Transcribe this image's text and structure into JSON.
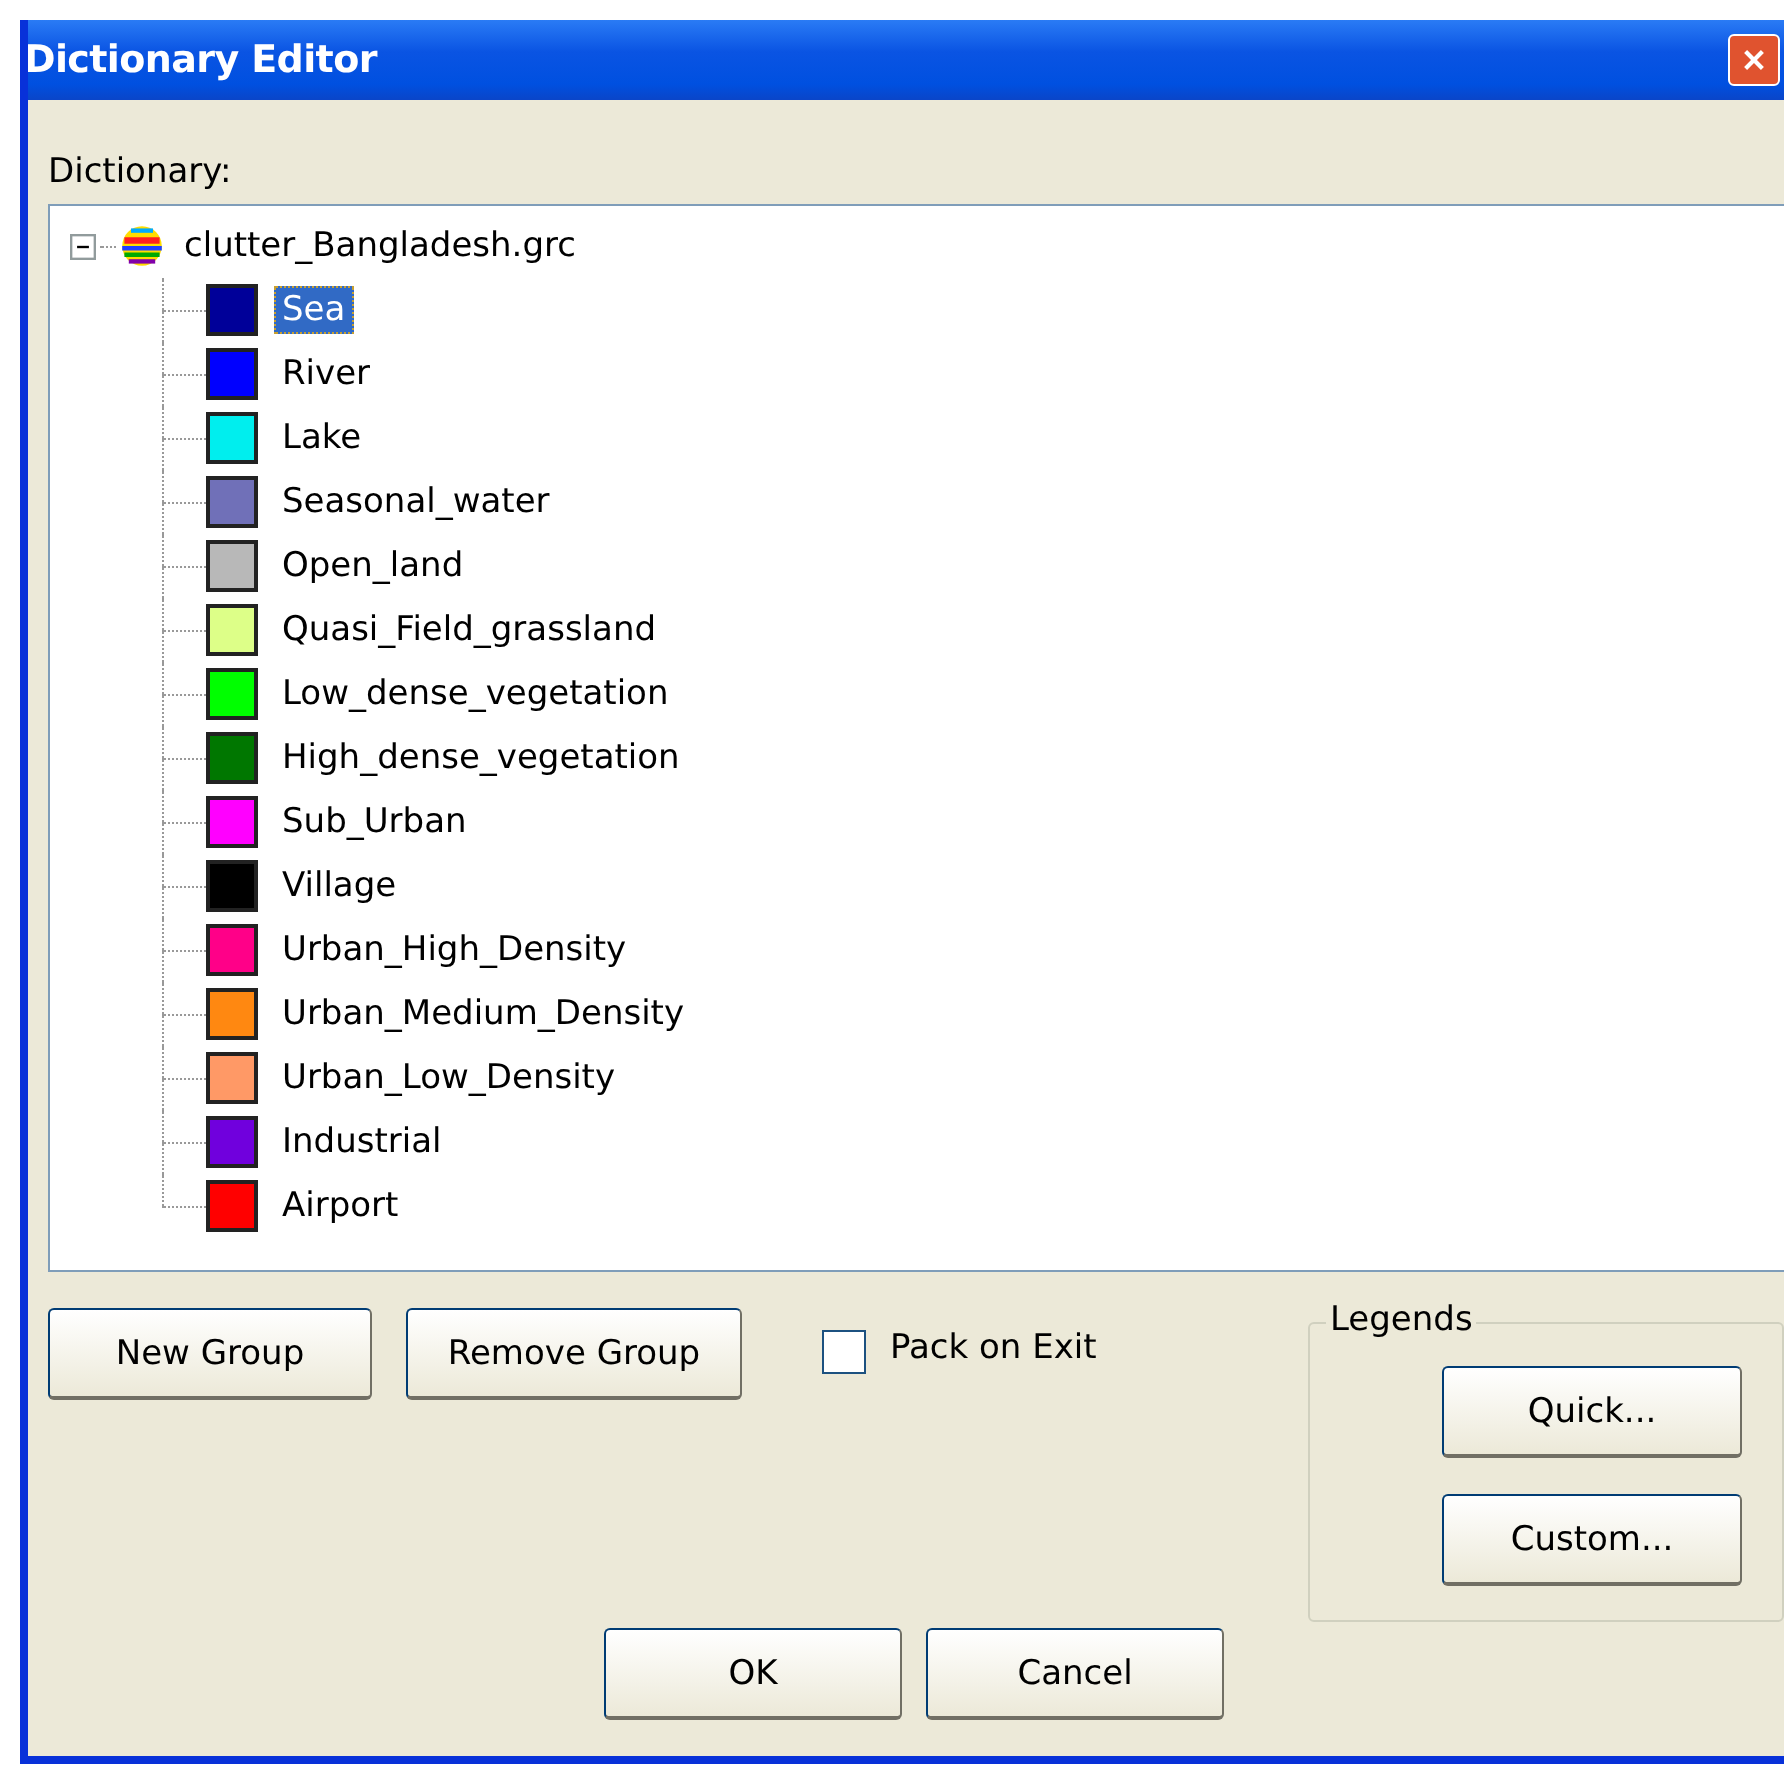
{
  "window": {
    "title": "Dictionary Editor"
  },
  "dictionary_label": "Dictionary:",
  "tree": {
    "label": "clutter_Bangladesh.grc",
    "expanded": true,
    "children": [
      {
        "label": "Sea",
        "color": "#000099",
        "selected": true
      },
      {
        "label": "River",
        "color": "#0000ff",
        "selected": false
      },
      {
        "label": "Lake",
        "color": "#00eeee",
        "selected": false
      },
      {
        "label": "Seasonal_water",
        "color": "#7070b8",
        "selected": false
      },
      {
        "label": "Open_land",
        "color": "#b8b8b8",
        "selected": false
      },
      {
        "label": "Quasi_Field_grassland",
        "color": "#ddff88",
        "selected": false
      },
      {
        "label": "Low_dense_vegetation",
        "color": "#00ff00",
        "selected": false
      },
      {
        "label": "High_dense_vegetation",
        "color": "#007700",
        "selected": false
      },
      {
        "label": "Sub_Urban",
        "color": "#ff00ff",
        "selected": false
      },
      {
        "label": "Village",
        "color": "#000000",
        "selected": false
      },
      {
        "label": "Urban_High_Density",
        "color": "#ff0088",
        "selected": false
      },
      {
        "label": "Urban_Medium_Density",
        "color": "#ff8811",
        "selected": false
      },
      {
        "label": "Urban_Low_Density",
        "color": "#ff9966",
        "selected": false
      },
      {
        "label": "Industrial",
        "color": "#7000dd",
        "selected": false
      },
      {
        "label": "Airport",
        "color": "#ff0000",
        "selected": false
      }
    ]
  },
  "group_buttons": [
    "New Group",
    "Remove Group"
  ],
  "pack_on_exit": {
    "label": "Pack on Exit",
    "checked": false
  },
  "legends": {
    "title": "Legends",
    "buttons": [
      "Quick...",
      "Custom..."
    ]
  },
  "dialog_buttons": [
    "OK",
    "Cancel"
  ]
}
